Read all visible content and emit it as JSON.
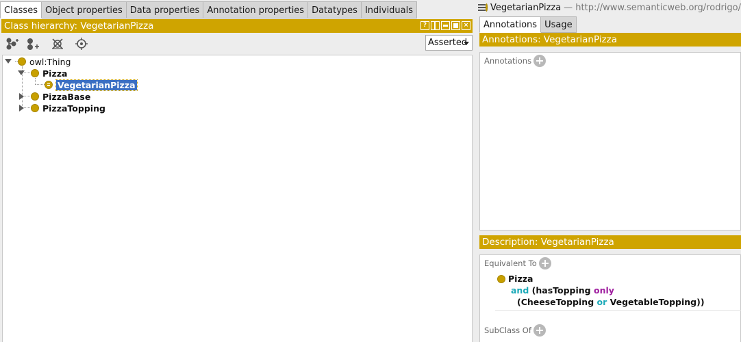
{
  "left_tabs": [
    "Classes",
    "Object properties",
    "Data properties",
    "Annotation properties",
    "Datatypes",
    "Individuals"
  ],
  "hierarchy": {
    "header": "Class hierarchy: VegetarianPizza",
    "mode": "Asserted",
    "toolbar_icons": [
      "add-subclass-icon",
      "add-sibling-class-icon",
      "delete-class-icon",
      "target-icon"
    ],
    "header_buttons": [
      "help-icon",
      "split-view-icon",
      "minimize-icon",
      "maximize-icon",
      "close-icon"
    ],
    "nodes": {
      "thing": "owl:Thing",
      "pizza": "Pizza",
      "vegetarian": "VegetarianPizza",
      "base": "PizzaBase",
      "topping": "PizzaTopping"
    }
  },
  "entity": {
    "name": "VegetarianPizza",
    "iri": "— http://www.semanticweb.org/rodrigo/"
  },
  "right_tabs": [
    "Annotations",
    "Usage"
  ],
  "annotations": {
    "header": "Annotations: VegetarianPizza",
    "label": "Annotations"
  },
  "description": {
    "header": "Description: VegetarianPizza",
    "equivalent_label": "Equivalent To",
    "subclass_label": "SubClass Of",
    "expr": {
      "class": "Pizza",
      "and": "and",
      "prop": "(hasTopping",
      "only": "only",
      "open": "(CheeseTopping",
      "or": "or",
      "close": "VegetableTopping))"
    }
  },
  "colors": {
    "header_gold": "#cfa400",
    "class_dot": "#c8a000",
    "selection": "#3b6fc2",
    "keyword_teal": "#1aa9b8",
    "keyword_purple": "#a020a0"
  }
}
